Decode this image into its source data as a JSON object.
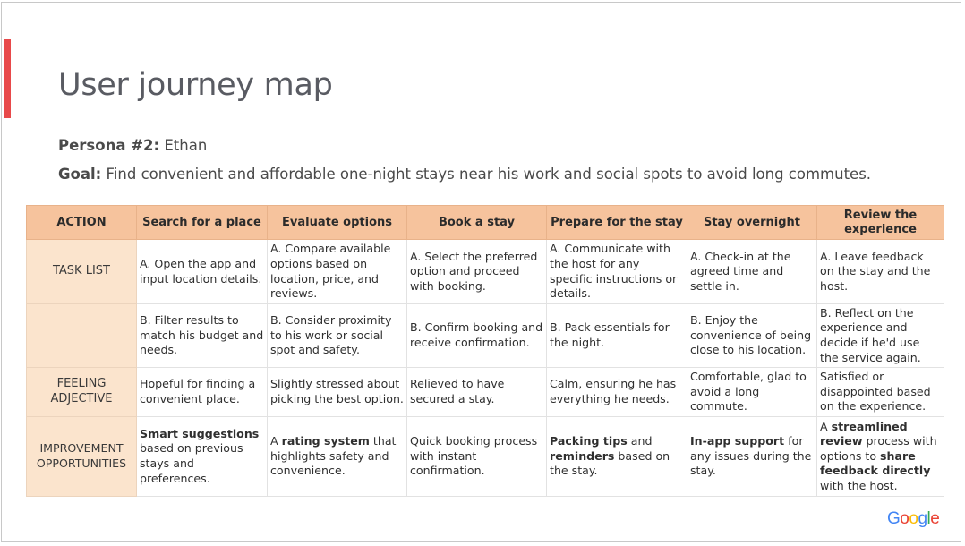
{
  "slide": {
    "title": "User journey map",
    "persona_label": "Persona #2:",
    "persona_value": " Ethan",
    "goal_label": "Goal:",
    "goal_value": " Find convenient and affordable one-night stays near his work and social spots to avoid long commutes.",
    "accent_color": "#e8494a",
    "header_color": "#f6c39d",
    "row_label_color": "#fbe4cd"
  },
  "table": {
    "corner_header": "ACTION",
    "columns": [
      "Search for a place",
      "Evaluate options",
      "Book a stay",
      "Prepare for the stay",
      "Stay overnight",
      "Review the experience"
    ],
    "rows": [
      {
        "label": "TASK LIST",
        "cells": [
          [
            {
              "t": "A. Open the app and input location details."
            }
          ],
          [
            {
              "t": "A. Compare available options based on location, price, and reviews."
            }
          ],
          [
            {
              "t": "A. Select the preferred option and proceed with booking."
            }
          ],
          [
            {
              "t": "A. Communicate with the host for any specific instructions or details."
            }
          ],
          [
            {
              "t": "A. Check-in at the agreed time and settle in."
            }
          ],
          [
            {
              "t": "A. Leave feedback on the stay and the host."
            }
          ]
        ]
      },
      {
        "label": "",
        "cells": [
          [
            {
              "t": "B. Filter results to match his budget and needs."
            }
          ],
          [
            {
              "t": "B. Consider proximity to his work or social spot and safety."
            }
          ],
          [
            {
              "t": "B. Confirm booking and receive confirmation."
            }
          ],
          [
            {
              "t": "B. Pack essentials for the night."
            }
          ],
          [
            {
              "t": "B. Enjoy the convenience of being close to his location."
            }
          ],
          [
            {
              "t": "B. Reflect on the experience and decide if he'd use the service again."
            }
          ]
        ]
      },
      {
        "label": "FEELING ADJECTIVE",
        "cells": [
          [
            {
              "t": "Hopeful for finding a convenient place."
            }
          ],
          [
            {
              "t": "Slightly stressed about picking the best option."
            }
          ],
          [
            {
              "t": "Relieved to have secured a stay."
            }
          ],
          [
            {
              "t": "Calm, ensuring he has everything he needs."
            }
          ],
          [
            {
              "t": "Comfortable, glad to avoid a long commute."
            }
          ],
          [
            {
              "t": "Satisfied or disappointed based on the experience."
            }
          ]
        ]
      },
      {
        "label": "IMPROVEMENT OPPORTUNITIES",
        "cells": [
          [
            {
              "t": "Smart suggestions",
              "b": true
            },
            {
              "t": " based on previous stays and preferences."
            }
          ],
          [
            {
              "t": "A "
            },
            {
              "t": "rating system",
              "b": true
            },
            {
              "t": " that highlights safety and convenience."
            }
          ],
          [
            {
              "t": "Quick booking process with instant confirmation."
            }
          ],
          [
            {
              "t": "Packing tips",
              "b": true
            },
            {
              "t": " and "
            },
            {
              "t": "reminders",
              "b": true
            },
            {
              "t": " based on the stay."
            }
          ],
          [
            {
              "t": "In-app support",
              "b": true
            },
            {
              "t": " for any issues during the stay."
            }
          ],
          [
            {
              "t": "A "
            },
            {
              "t": "streamlined review",
              "b": true
            },
            {
              "t": " process with options to "
            },
            {
              "t": "share feedback directly",
              "b": true
            },
            {
              "t": " with the host."
            }
          ]
        ]
      }
    ]
  },
  "footer": {
    "logo_letters": [
      {
        "ch": "G",
        "color": "blue"
      },
      {
        "ch": "o",
        "color": "red"
      },
      {
        "ch": "o",
        "color": "yellow"
      },
      {
        "ch": "g",
        "color": "blue"
      },
      {
        "ch": "l",
        "color": "green"
      },
      {
        "ch": "e",
        "color": "red"
      }
    ]
  }
}
